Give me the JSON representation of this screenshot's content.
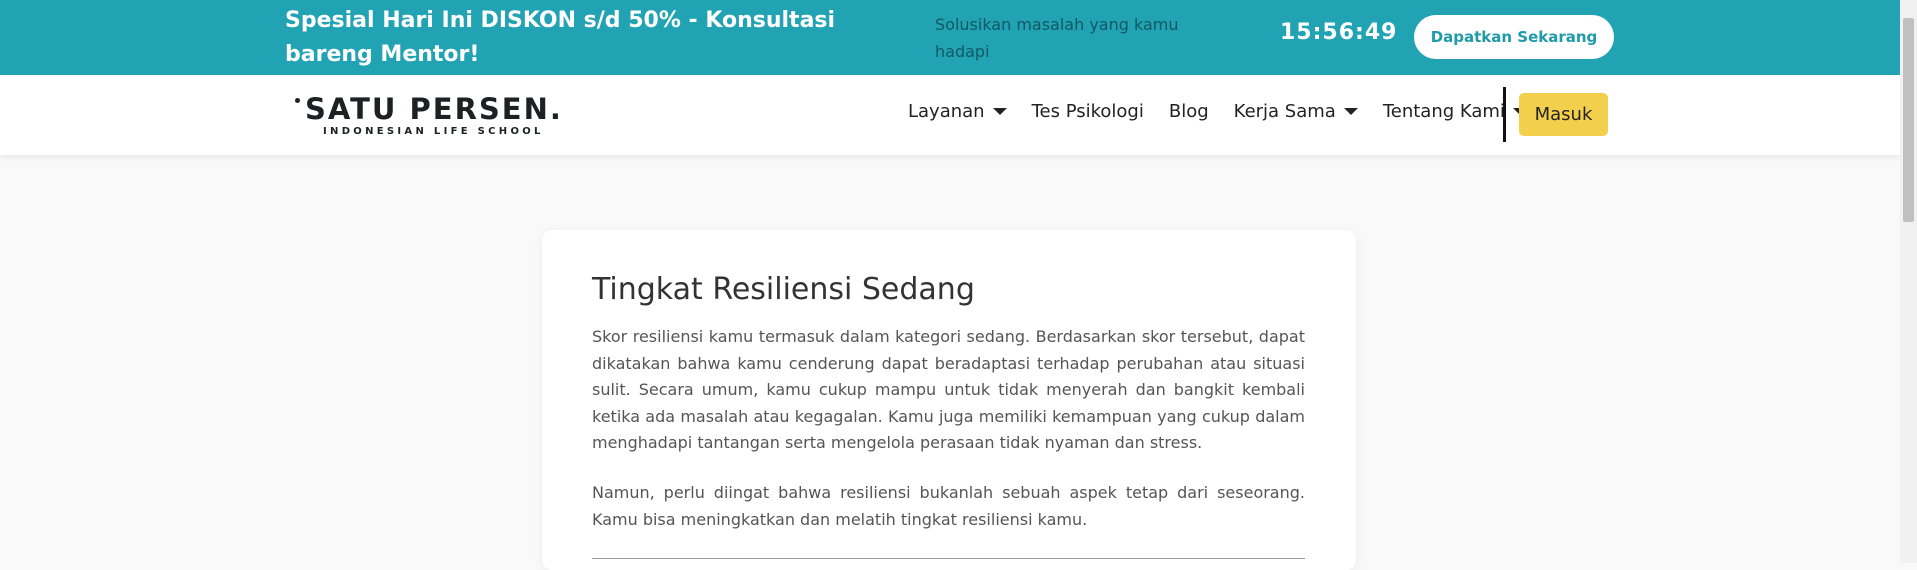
{
  "promo": {
    "title": "Spesial Hari Ini DISKON s/d 50% - Konsultasi bareng Mentor!",
    "subtitle": "Solusikan masalah yang kamu hadapi",
    "timer": "15:56:49",
    "cta_label": "Dapatkan Sekarang"
  },
  "nav": {
    "logo_main": "SATU PERSEN.",
    "logo_sub": "INDONESIAN LIFE SCHOOL",
    "items": [
      {
        "label": "Layanan",
        "dropdown": true
      },
      {
        "label": "Tes Psikologi",
        "dropdown": false
      },
      {
        "label": "Blog",
        "dropdown": false
      },
      {
        "label": "Kerja Sama",
        "dropdown": true
      },
      {
        "label": "Tentang Kami",
        "dropdown": true
      }
    ],
    "login_label": "Masuk"
  },
  "content": {
    "title": "Tingkat Resiliensi Sedang",
    "paragraph1": "Skor resiliensi kamu termasuk dalam kategori sedang. Berdasarkan skor tersebut, dapat dikatakan bahwa kamu cenderung dapat beradaptasi terhadap perubahan atau situasi sulit. Secara umum, kamu cukup mampu untuk tidak menyerah dan bangkit kembali ketika ada masalah atau kegagalan. Kamu juga memiliki kemampuan yang cukup dalam menghadapi tantangan serta mengelola perasaan tidak nyaman dan stress.",
    "paragraph2": "Namun, perlu diingat bahwa resiliensi bukanlah sebuah aspek tetap dari seseorang. Kamu bisa meningkatkan dan melatih tingkat resiliensi kamu."
  },
  "colors": {
    "banner": "#22a3b3",
    "login_button": "#f3d04b",
    "cta_text": "#1f9aa9"
  }
}
